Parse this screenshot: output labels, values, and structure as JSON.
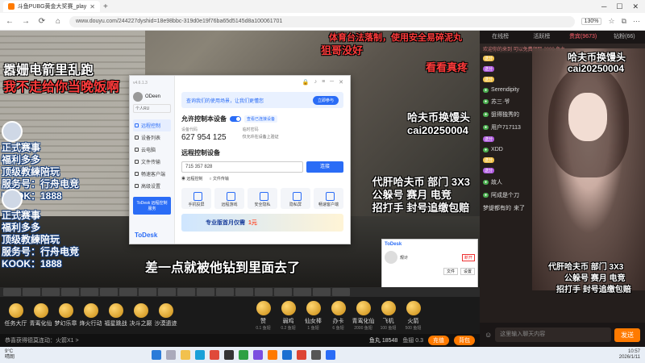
{
  "browser": {
    "tab_title": "斗鱼PUBG黄金大奖赛_play",
    "url": "www.douyu.com/244227dyshid=18e98bbc-319d0e19f76ba65d5145d8a100061701",
    "zoom": "130%"
  },
  "video": {
    "danmu": [
      {
        "text": "体育台法落制，使用安全易碎泥丸",
        "color": "#ff3b3b"
      },
      {
        "text": "狙哥没好",
        "color": "#ff3b3b"
      },
      {
        "text": "看看真疼",
        "color": "#ff3b3b"
      },
      {
        "text": "嚣姗电箭里乱跑",
        "color": "#ffffff"
      },
      {
        "text": "我不走给你当晚饭啊",
        "color": "#ff3b3b"
      }
    ],
    "left_stickers": [
      [
        "正式赛事",
        "福利多多",
        "顶级教練陪玩",
        "服务号：行舟电竞",
        "KOOK：1888"
      ],
      [
        "正式赛事",
        "福利多多",
        "顶级教練陪玩",
        "服务号：行舟电竞",
        "KOOK：1888"
      ]
    ],
    "ad_block": [
      "哈夫币换馒头",
      "cai20250004",
      "代肝哈夫币 部门 3X3",
      "公躲号 赛月 电竞",
      "招打手 封号追缴包赔"
    ],
    "subtitle": "差一点就被他钻到里面去了"
  },
  "todesk": {
    "version": "v4.6.1.3",
    "username": "ODeen",
    "personal": "个人RU",
    "menu": [
      "远程控制",
      "设备列表",
      "云电脑",
      "文件传输",
      "畅速客户端",
      "高级设置"
    ],
    "menu_ad": "ToDesk 远程控制服务",
    "logo": "ToDesk",
    "banner_text": "查询我们的使用场景，让我们更懂您",
    "banner_btn": "立即参与",
    "allow_title": "允许控制本设备",
    "allow_hint": "查看已连接设备",
    "device_code_label": "设备代码",
    "device_code": "627 954 125",
    "temp_pwd_label": "临时密码",
    "temp_pwd_sub": "仅允许在设备上验证",
    "remote_title": "远程控制设备",
    "remote_input": "715 357 828",
    "connect_btn": "连接",
    "radio_remote": "远程控制",
    "radio_file": "文件传输",
    "tools": [
      "手机投屏",
      "远程游戏",
      "安全隐私",
      "隐私屏",
      "畅速客户端"
    ],
    "promo_text": "专业版首月仅需",
    "promo_price": "1元",
    "mini_logo": "ToDesk",
    "mini_name": "规计",
    "mini_btn": "断开",
    "mini_buttons": [
      "文件",
      "设置"
    ]
  },
  "gifts": [
    {
      "name": "任务大厅",
      "sub": ""
    },
    {
      "name": "青鸾化仙",
      "sub": ""
    },
    {
      "name": "梦幻乐章",
      "sub": ""
    },
    {
      "name": "烽火行动",
      "sub": ""
    },
    {
      "name": "福星跳战",
      "sub": ""
    },
    {
      "name": "决斗之巅",
      "sub": ""
    },
    {
      "name": "沙漠遗迹",
      "sub": ""
    },
    {
      "name": "赞",
      "sub": "0.1 鱼翅"
    },
    {
      "name": "弱鸡",
      "sub": "0.2 鱼翅"
    },
    {
      "name": "仙女棒",
      "sub": "1 鱼翅"
    },
    {
      "name": "办卡",
      "sub": "6 鱼翅"
    },
    {
      "name": "青鸾化仙",
      "sub": "2000 鱼翅"
    },
    {
      "name": "飞机",
      "sub": "100 鱼翅"
    },
    {
      "name": "火箭",
      "sub": "500 鱼翅"
    }
  ],
  "fans": {
    "notice": "恭喜获得德莫连动：火箭X1 >",
    "yuwan": "鱼丸 18548",
    "yuchi": "鱼翅 0.3",
    "recharge": "充值",
    "backpack": "背包"
  },
  "right_panel": {
    "tabs": [
      "在线榜",
      "活跃榜",
      "贵宾(9673)",
      "钻粉(66)"
    ],
    "topline": "欢迎你的来到 可以免费领取 2000 鱼丸",
    "chat": [
      {
        "user": "",
        "text": "",
        "badge": "送分"
      },
      {
        "user": "",
        "text": "",
        "badge": "送分"
      },
      {
        "user": "",
        "text": "",
        "badge": "送分"
      },
      {
        "user": "Serendipity",
        "text": "",
        "badge": ""
      },
      {
        "user": "苏三·爷",
        "text": "",
        "badge": ""
      },
      {
        "user": "狙得独秀的",
        "text": "",
        "badge": ""
      },
      {
        "user": "用户717113",
        "text": "",
        "badge": ""
      },
      {
        "user": "",
        "text": "",
        "badge": "送分"
      },
      {
        "user": "XDD",
        "text": "",
        "badge": ""
      },
      {
        "user": "",
        "text": "",
        "badge": "送分"
      },
      {
        "user": "",
        "text": "",
        "badge": "送分"
      },
      {
        "user": "故人",
        "text": "",
        "badge": ""
      },
      {
        "user": "阿成是个刀",
        "text": "",
        "badge": ""
      },
      {
        "user": "梦缇都有的",
        "text": "来了",
        "badge": ""
      }
    ],
    "input_placeholder": "这里输入聊天内容",
    "send": "发送"
  },
  "cam_text": {
    "line1": "哈夫币换馒头",
    "line2": "cai20250004",
    "line3": "代肝哈夫币 部门 3X3",
    "line4": "公躲号 赛月 电竞",
    "line5": "招打手 封号追缴包赔"
  },
  "taskbar": {
    "weather_temp": "9°C",
    "weather_desc": "晴朗",
    "time": "10:57",
    "date": "2026/1/11"
  }
}
